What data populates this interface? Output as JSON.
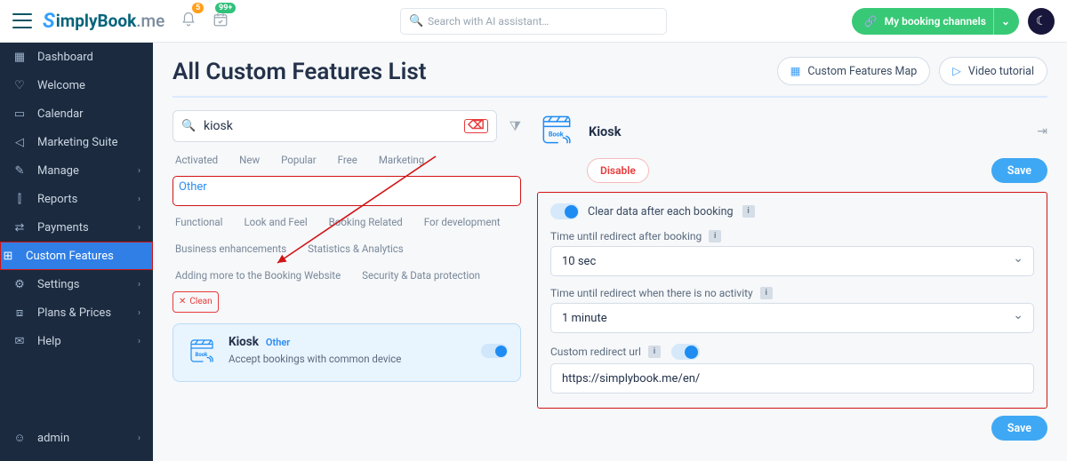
{
  "logo": {
    "simply": "SimplyBook",
    "dotme": ".me"
  },
  "topbar": {
    "bell_badge": "5",
    "cal_badge": "99+",
    "search_placeholder": "Search with AI assistant…",
    "channels": "My booking channels"
  },
  "sidebar": {
    "items": [
      {
        "label": "Dashboard",
        "icon": "▦",
        "chev": false
      },
      {
        "label": "Welcome",
        "icon": "♡",
        "chev": false
      },
      {
        "label": "Calendar",
        "icon": "▭",
        "chev": false
      },
      {
        "label": "Marketing Suite",
        "icon": "◁",
        "chev": false
      },
      {
        "label": "Manage",
        "icon": "✎",
        "chev": true
      },
      {
        "label": "Reports",
        "icon": "⫿",
        "chev": true
      },
      {
        "label": "Payments",
        "icon": "⇄",
        "chev": true
      },
      {
        "label": "Custom Features",
        "icon": "⊞",
        "chev": false,
        "active": true,
        "hilite": true
      },
      {
        "label": "Settings",
        "icon": "⚙",
        "chev": true
      },
      {
        "label": "Plans & Prices",
        "icon": "⧈",
        "chev": true
      },
      {
        "label": "Help",
        "icon": "✉",
        "chev": true
      }
    ],
    "admin": {
      "label": "admin",
      "icon": "☺",
      "chev": true
    }
  },
  "header": {
    "title": "All Custom Features List",
    "map_btn": "Custom Features Map",
    "video_btn": "Video tutorial"
  },
  "search": {
    "value": "kiosk",
    "clear": "⌫"
  },
  "chips": [
    "Activated",
    "New",
    "Popular",
    "Free",
    "Marketing",
    "Other",
    "Functional",
    "Look and Feel",
    "Booking Related",
    "For development",
    "Business enhancements",
    "Statistics & Analytics",
    "Adding more to the Booking Website",
    "Security & Data protection"
  ],
  "chips_selected_index": 5,
  "chips_clean": "Clean",
  "result": {
    "title": "Kiosk",
    "cat": "Other",
    "desc": "Accept bookings with common device"
  },
  "detail": {
    "title": "Kiosk",
    "disable": "Disable",
    "save": "Save",
    "clear_toggle": "Clear data after each booking",
    "t1_label": "Time until redirect after booking",
    "t1_value": "10 sec",
    "t2_label": "Time until redirect when there is no activity",
    "t2_value": "1 minute",
    "url_label": "Custom redirect url",
    "url_value": "https://simplybook.me/en/",
    "bottom_save": "Save"
  }
}
